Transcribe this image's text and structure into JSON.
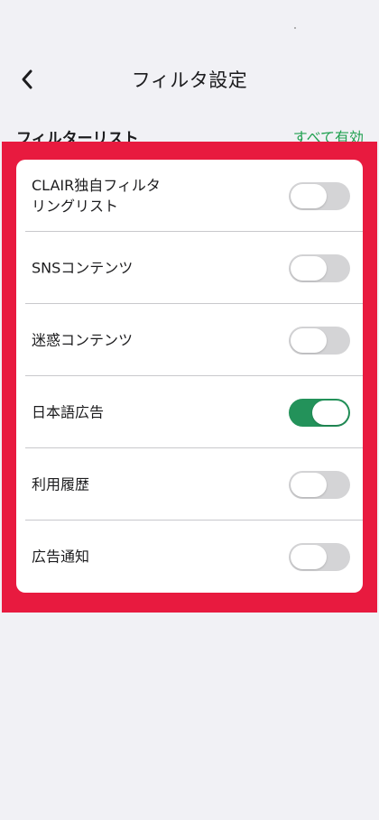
{
  "nav": {
    "title": "フィルタ設定",
    "back_icon": "chevron-left-icon"
  },
  "section": {
    "title": "フィルターリスト",
    "enable_all_label": "すべて有効"
  },
  "filters": [
    {
      "label": "CLAIR独自フィルタ\nリングリスト",
      "enabled": false
    },
    {
      "label": "SNSコンテンツ",
      "enabled": false
    },
    {
      "label": "迷惑コンテンツ",
      "enabled": false
    },
    {
      "label": "日本語広告",
      "enabled": true
    },
    {
      "label": "利用履歴",
      "enabled": false
    },
    {
      "label": "広告通知",
      "enabled": false
    }
  ],
  "colors": {
    "accent": "#20a050",
    "toggle_on": "#23925a",
    "toggle_off": "#d4d4d6",
    "highlight": "#e81a3f",
    "background": "#f1f1f5"
  }
}
